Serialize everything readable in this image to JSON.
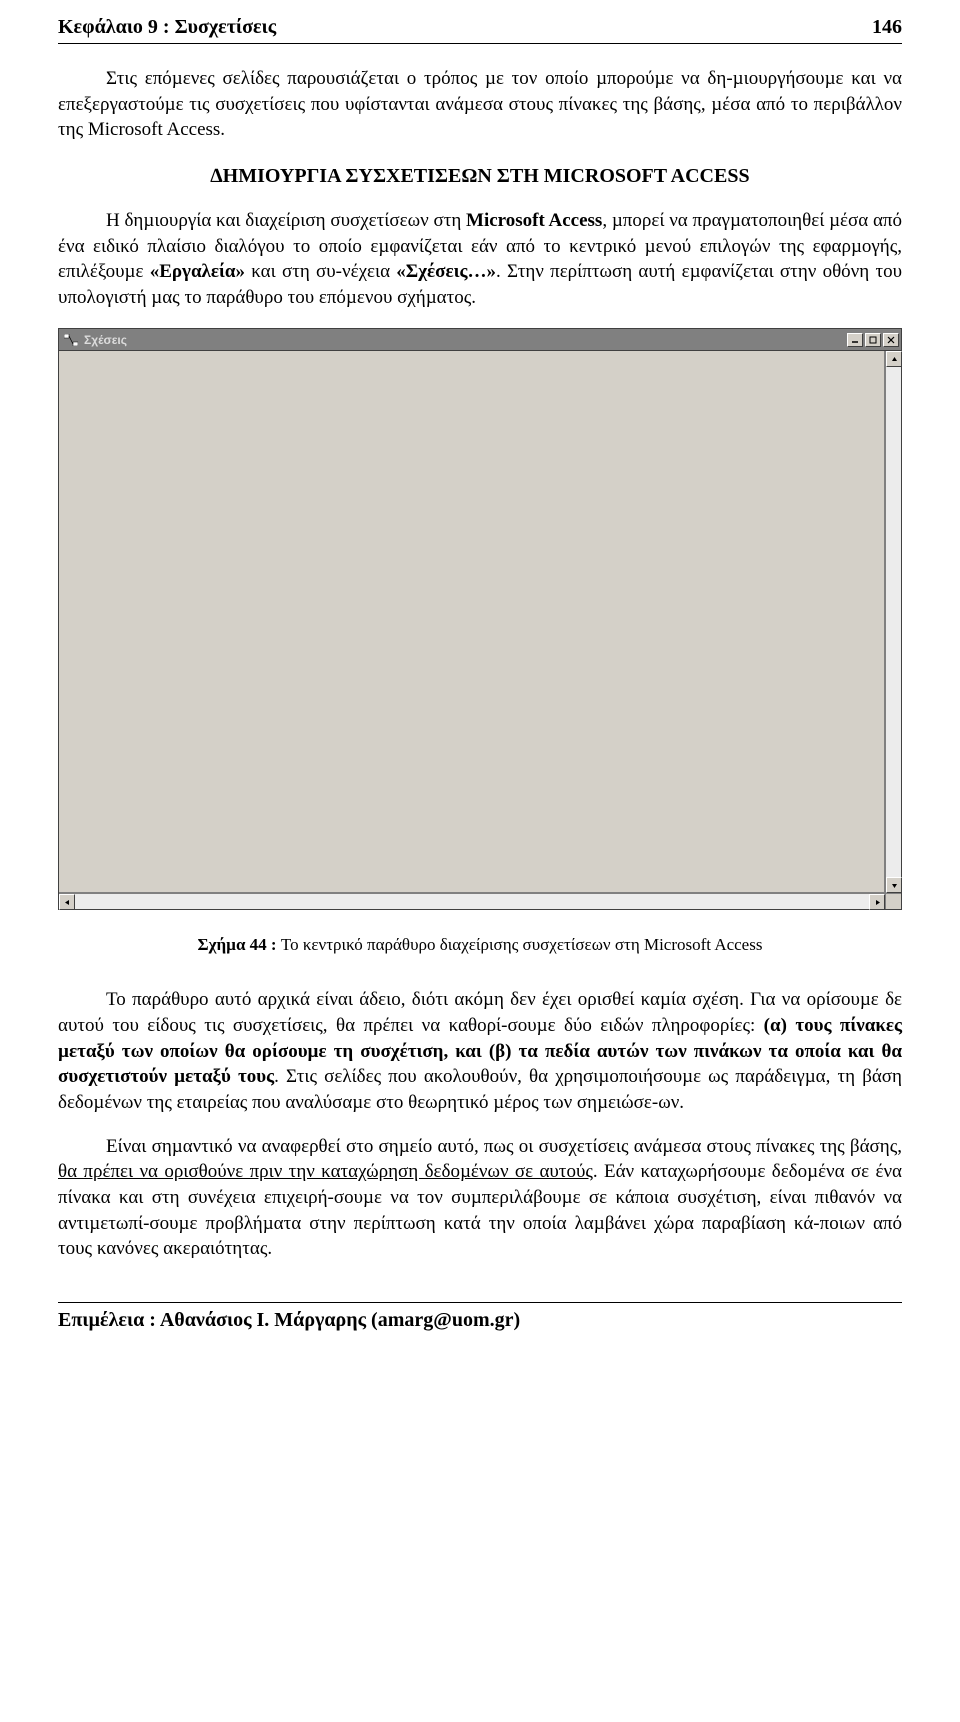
{
  "header": {
    "chapter": "Κεφάλαιο 9 : Συσχετίσεις",
    "page_number": "146"
  },
  "intro_para": "Στις επόµενες σελίδες παρουσιάζεται ο τρόπος µε τον οποίο µπορούµε να δη-µιουργήσουµε και να επεξεργαστούµε τις συσχετίσεις που υφίστανται ανάµεσα στους πίνακες της βάσης, µέσα από το περιβάλλον της Microsoft Access.",
  "section_heading": "∆ΗΜΙΟΥΡΓΙΑ ΣΥΣΧΕΤΙΣΕΩΝ ΣΤΗ MICROSOFT ACCESS",
  "para1_a": "Η δηµιουργία και διαχείριση συσχετίσεων στη ",
  "para1_b": "Microsoft Access",
  "para1_c": ", µπορεί να πραγµατοποιηθεί  µέσα από ένα ειδικό πλαίσιο διαλόγου το οποίο εµφανίζεται εάν από το κεντρικό µενού επιλογών της εφαρµογής, επιλέξουµε ",
  "para1_d": "«Εργαλεία»",
  "para1_e": " και στη συ-νέχεια ",
  "para1_f": "«Σχέσεις…»",
  "para1_g": ". Στην περίπτωση αυτή εµφανίζεται στην οθόνη του υπολογιστή µας το παράθυρο του επόµενου σχήµατος.",
  "window": {
    "title": "Σχέσεις"
  },
  "caption_prefix": "Σχήµα 44 : ",
  "caption_text": "Το κεντρικό παράθυρο διαχείρισης συσχετίσεων στη Microsoft Access",
  "para2_a": "Το παράθυρο αυτό αρχικά είναι άδειο, διότι ακόµη δεν έχει ορισθεί καµία σχέση. Για να ορίσουµε δε αυτού του είδους τις συσχετίσεις, θα πρέπει να καθορί-σουµε δύο ειδών πληροφορίες: ",
  "para2_b": "(α) τους πίνακες µεταξύ των οποίων θα ορίσουµε τη συσχέτιση, και (β) τα πεδία αυτών των πινάκων τα οποία και θα συσχετιστούν µεταξύ τους",
  "para2_c": ". Στις σελίδες που ακολουθούν, θα χρησιµοποιήσουµε ως παράδειγµα, τη βάση δεδοµένων της εταιρείας που αναλύσαµε στο θεωρητικό µέρος των σηµειώσε-ων.",
  "para3_a": "Είναι σηµαντικό να αναφερθεί στο σηµείο αυτό, πως οι συσχετίσεις ανάµεσα στους πίνακες της βάσης, ",
  "para3_b": "θα πρέπει να ορισθούνε πριν την καταχώρηση δεδοµένων σε αυτούς",
  "para3_c": ". Εάν καταχωρήσουµε δεδοµένα σε ένα πίνακα και στη συνέχεια επιχειρή-σουµε να τον συµπεριλάβουµε σε κάποια συσχέτιση, είναι πιθανόν να αντιµετωπί-σουµε προβλήµατα στην περίπτωση κατά την οποία λαµβάνει χώρα παραβίαση κά-ποιων από τους κανόνες ακεραιότητας.",
  "footer": "Επιµέλεια : Αθανάσιος Ι. Μάργαρης (amarg@uom.gr)"
}
